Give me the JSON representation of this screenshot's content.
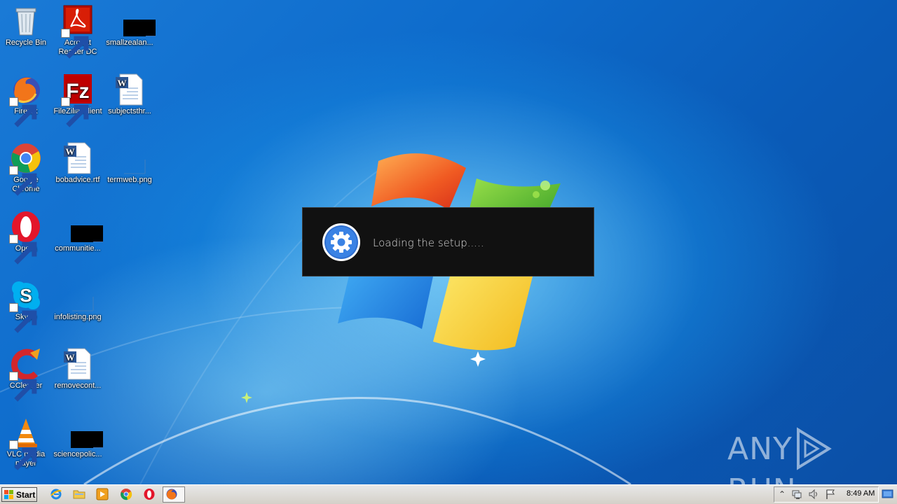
{
  "desktop": {
    "icons": [
      {
        "label": "Recycle Bin",
        "icon": "recycle-bin-icon"
      },
      {
        "label": "Acrobat Reader DC",
        "icon": "acrobat-icon"
      },
      {
        "label": "smallzealan...",
        "icon": "blank-file-icon"
      },
      {
        "label": "Firefox",
        "icon": "firefox-icon"
      },
      {
        "label": "FileZilla Client",
        "icon": "filezilla-icon"
      },
      {
        "label": "subjectsthr...",
        "icon": "word-doc-icon"
      },
      {
        "label": "Google Chrome",
        "icon": "chrome-icon"
      },
      {
        "label": "bobadvice.rtf",
        "icon": "word-doc-icon"
      },
      {
        "label": "termweb.png",
        "icon": "png-file-icon"
      },
      {
        "label": "Opera",
        "icon": "opera-icon"
      },
      {
        "label": "communitie...",
        "icon": "blank-file-icon"
      },
      {
        "label": "Skype",
        "icon": "skype-icon"
      },
      {
        "label": "infolisting.png",
        "icon": "png-file-icon"
      },
      {
        "label": "CCleaner",
        "icon": "ccleaner-icon"
      },
      {
        "label": "removecont...",
        "icon": "word-doc-icon"
      },
      {
        "label": "VLC media player",
        "icon": "vlc-icon"
      },
      {
        "label": "sciencepolic...",
        "icon": "blank-file-icon"
      }
    ]
  },
  "dialog": {
    "message": "Loading the setup.....",
    "icon": "gear-icon"
  },
  "watermark": {
    "text_left": "ANY",
    "text_right": "RUN"
  },
  "taskbar": {
    "start_label": "Start",
    "pinned": [
      "internet-explorer-icon",
      "explorer-folder-icon",
      "media-player-icon",
      "chrome-icon",
      "opera-icon",
      "firefox-icon"
    ],
    "clock": "8:49 AM"
  },
  "colors": {
    "dialog_bg": "#111111",
    "desktop_blue": "#1a7ad6"
  }
}
